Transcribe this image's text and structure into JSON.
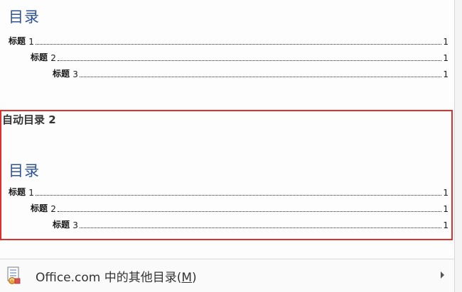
{
  "gallery_top": {
    "heading": "目录",
    "entries": [
      {
        "label": "标题 ",
        "num": "1",
        "page": "1"
      },
      {
        "label": "标题 ",
        "num": "2",
        "page": "1"
      },
      {
        "label": "标题 ",
        "num": "3",
        "page": "1"
      }
    ]
  },
  "gallery_auto2": {
    "title": "自动目录 2",
    "heading": "目录",
    "entries": [
      {
        "label": "标题 ",
        "num": "1",
        "page": "1"
      },
      {
        "label": "标题 ",
        "num": "2",
        "page": "1"
      },
      {
        "label": "标题 ",
        "num": "3",
        "page": "1"
      }
    ]
  },
  "footer": {
    "more_text": "Office.com 中的其他目录(",
    "more_accel": "M",
    "more_close": ")",
    "icon": "office-toc-icon"
  },
  "colors": {
    "heading": "#2f5496",
    "highlight_frame": "#e0302c"
  }
}
